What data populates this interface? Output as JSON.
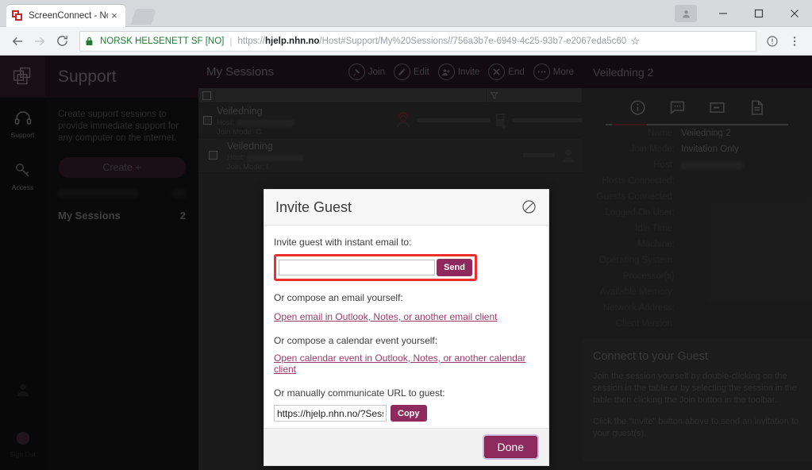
{
  "browser": {
    "tab": {
      "title": "ScreenConnect - Norsk H",
      "favicon": "screenconnect-icon",
      "close": "×"
    },
    "newtab_label": "+",
    "window_controls": {
      "profile": "profile-avatar",
      "minimize": "–",
      "maximize": "□",
      "close": "✕"
    },
    "nav": {
      "back": "←",
      "forward": "→",
      "reload": "⟳"
    },
    "omnibox": {
      "lock": "lock-icon",
      "site_identity": "NORSK HELSENETT SF [NO]",
      "separator": "|",
      "url_prefix": "https://",
      "url_domain": "hjelp.nhn.no",
      "url_path": "/Host#Support/My%20Sessions//756a3b7e-6949-4c25-93b7-e2067eda5c60",
      "star": "☆"
    },
    "toolbar_right": {
      "info": "info-icon",
      "menu": "⋮"
    }
  },
  "rail": {
    "logo": "screenconnect-logo",
    "items": [
      {
        "icon": "headset-icon",
        "label": "Support"
      },
      {
        "icon": "key-icon",
        "label": "Access"
      }
    ],
    "bottom_items": [
      {
        "icon": "user-icon",
        "label": ""
      },
      {
        "icon": "avatar-icon",
        "label": "Sign Out"
      }
    ]
  },
  "support_panel": {
    "title": "Support",
    "description": "Create support sessions to provide immediate support for any computer on the internet.",
    "create_button": "Create +",
    "sessions_label": "My Sessions",
    "sessions_count": "2",
    "footer": ""
  },
  "sessions_panel": {
    "title": "My Sessions",
    "toolbar": [
      {
        "label": "Join",
        "icon": "plug-icon"
      },
      {
        "label": "Edit",
        "icon": "pencil-icon"
      },
      {
        "label": "Invite",
        "icon": "user-plus-icon"
      },
      {
        "label": "End",
        "icon": "x-icon"
      },
      {
        "label": "More",
        "icon": "ellipsis-icon"
      }
    ],
    "grid_header": {
      "select_all": "checkbox",
      "filter": "filter-icon"
    },
    "rows": [
      {
        "name": "Veiledning",
        "host_label": "Host:",
        "host_value": "",
        "join_mode_label": "Join Mode:",
        "join_mode_value": "C"
      },
      {
        "name": "Veiledning",
        "host_label": "Host:",
        "host_value": "",
        "join_mode_label": "Join Mode:",
        "join_mode_value": "I"
      }
    ]
  },
  "detail_panel": {
    "title": "Veiledning 2",
    "tabs": [
      {
        "icon": "info-circle-icon",
        "active": true
      },
      {
        "icon": "chat-icon",
        "active": false
      },
      {
        "icon": "note-icon",
        "active": false
      },
      {
        "icon": "document-icon",
        "active": false
      }
    ],
    "fields": [
      {
        "label": "Name:",
        "value": "Veiledning 2",
        "redacted": false
      },
      {
        "label": "Join Mode:",
        "value": "Invitation Only",
        "redacted": false
      },
      {
        "label": "Host:",
        "value": "",
        "redacted": true
      },
      {
        "label": "Hosts Connected:",
        "value": "",
        "redacted": false
      },
      {
        "label": "Guests Connected:",
        "value": "",
        "redacted": false
      },
      {
        "label": "Logged On User:",
        "value": "",
        "redacted": false
      },
      {
        "label": "Idle Time:",
        "value": "",
        "redacted": false
      },
      {
        "label": "Machine:",
        "value": "",
        "redacted": false
      },
      {
        "label": "Operating System:",
        "value": "",
        "redacted": false
      },
      {
        "label": "Processor(s)",
        "value": "",
        "redacted": false
      },
      {
        "label": "Available Memory:",
        "value": "",
        "redacted": false
      },
      {
        "label": "Network Address:",
        "value": "",
        "redacted": false
      },
      {
        "label": "Client Version:",
        "value": "",
        "redacted": false
      }
    ],
    "card": {
      "heading": "Connect to your Guest",
      "paragraph1": "Join the session yourself by double-clicking on the session in the table or by selecting the session in the table then clicking the Join button in the toolbar.",
      "paragraph2": "Click the \"Invite\" button above to send an invitation to your guest(s)."
    }
  },
  "modal": {
    "title": "Invite Guest",
    "close_icon": "close-circle-icon",
    "email_label": "Invite guest with instant email to:",
    "email_value": "",
    "email_placeholder": "",
    "send_button": "Send",
    "compose_email_label": "Or compose an email yourself:",
    "compose_email_link": "Open email in Outlook, Notes, or another email client",
    "compose_calendar_label": "Or compose a calendar event yourself:",
    "compose_calendar_link": "Open calendar event in Outlook, Notes, or another calendar client",
    "manual_url_label": "Or manually communicate URL to guest:",
    "url_value": "https://hjelp.nhn.no/?Sessio",
    "copy_button": "Copy",
    "done_button": "Done"
  },
  "colors": {
    "brand_purple": "#8e2a5e",
    "header_maroon": "#2e1a26",
    "highlight_red": "#ee2d2d",
    "link_purple": "#9c3a6a",
    "accent_underline": "#8c2b3f"
  }
}
